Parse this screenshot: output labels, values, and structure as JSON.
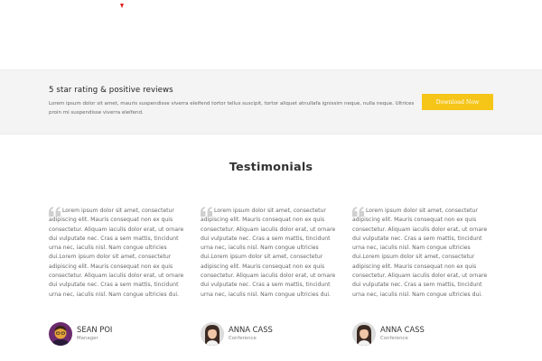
{
  "promo": {
    "title": "5 star rating & positive reviews",
    "description": "Lorem ipsum dolor sit amet, mauris suspendisse viverra eleifend tortor tellus suscipit, tortor aliquet atnullafa ignissim neque, nulla neque. Ultrices proin mi suspendisse viverra eleifend.",
    "button_label": "Download Now",
    "button_color": "#f5c518"
  },
  "testimonials": {
    "title": "Testimonials",
    "items": [
      {
        "text": "Lorem ipsum dolor sit amet, consectetur adipiscing elit. Mauris consequat non ex quis consectetur. Aliquam iaculis dolor erat, ut ornare dui vulputate nec. Cras a sem mattis, tincidunt urna nec, iaculis nisl. Nam congue ultricies dui.Lorem ipsum dolor sit amet, consectetur adipiscing elit. Mauris consequat non ex quis consectetur. Aliquam iaculis dolor erat, ut ornare dui vulputate nec. Cras a sem mattis, tincidunt urna nec, iaculis nisl. Nam congue ultricies dui.",
        "name": "SEAN POI",
        "role": "Manager",
        "avatar_icon": "avatar-man-glasses"
      },
      {
        "text": "Lorem ipsum dolor sit amet, consectetur adipiscing elit. Mauris consequat non ex quis consectetur. Aliquam iaculis dolor erat, ut ornare dui vulputate nec. Cras a sem mattis, tincidunt urna nec, iaculis nisl. Nam congue ultricies dui.Lorem ipsum dolor sit amet, consectetur adipiscing elit. Mauris consequat non ex quis consectetur. Aliquam iaculis dolor erat, ut ornare dui vulputate nec. Cras a sem mattis, tincidunt urna nec, iaculis nisl. Nam congue ultricies dui.",
        "name": "ANNA CASS",
        "role": "Conference",
        "avatar_icon": "avatar-woman"
      },
      {
        "text": "Lorem ipsum dolor sit amet, consectetur adipiscing elit. Mauris consequat non ex quis consectetur. Aliquam iaculis dolor erat, ut ornare dui vulputate nec. Cras a sem mattis, tincidunt urna nec, iaculis nisl. Nam congue ultricies dui.Lorem ipsum dolor sit amet, consectetur adipiscing elit. Mauris consequat non ex quis consectetur. Aliquam iaculis dolor erat, ut ornare dui vulputate nec. Cras a sem mattis, tincidunt urna nec, iaculis nisl. Nam congue ultricies dui.",
        "name": "ANNA CASS",
        "role": "Conference",
        "avatar_icon": "avatar-woman"
      }
    ]
  }
}
